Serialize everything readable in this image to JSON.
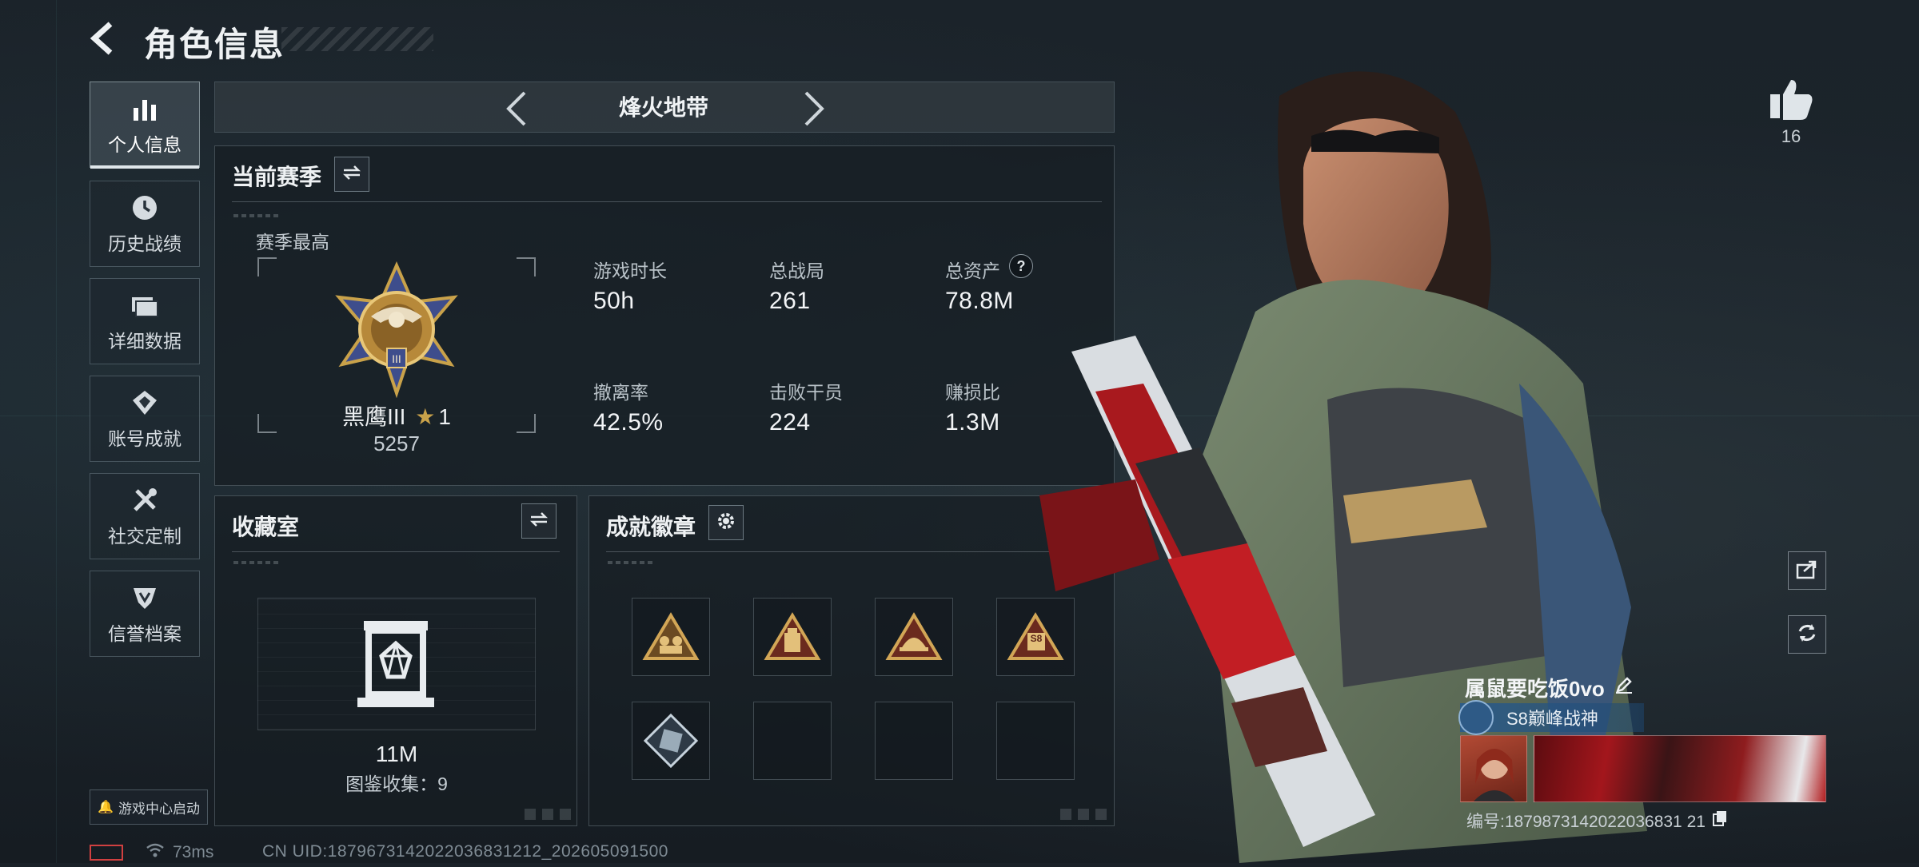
{
  "header": {
    "title": "角色信息"
  },
  "sidebar": {
    "items": [
      {
        "label": "个人信息",
        "icon": "bar-chart-icon",
        "active": true
      },
      {
        "label": "历史战绩",
        "icon": "clock-icon",
        "active": false
      },
      {
        "label": "详细数据",
        "icon": "folder-icon",
        "active": false
      },
      {
        "label": "账号成就",
        "icon": "achievement-icon",
        "active": false
      },
      {
        "label": "社交定制",
        "icon": "tools-icon",
        "active": false
      },
      {
        "label": "信誉档案",
        "icon": "shield-icon",
        "active": false
      }
    ],
    "launch_label": "游戏中心启动"
  },
  "status": {
    "ping": "73ms",
    "uid": "CN UID:1879673142022036831212_202605091500"
  },
  "mode": {
    "title": "烽火地带"
  },
  "season": {
    "title": "当前赛季",
    "highest_label": "赛季最高",
    "rank_name": "黑鹰III",
    "rank_stars": "1",
    "rank_score": "5257",
    "stats": [
      {
        "label": "游戏时长",
        "value": "50h"
      },
      {
        "label": "总战局",
        "value": "261"
      },
      {
        "label": "总资产",
        "value": "78.8M",
        "help": "?"
      },
      {
        "label": "撤离率",
        "value": "42.5%"
      },
      {
        "label": "击败干员",
        "value": "224"
      },
      {
        "label": "赚损比",
        "value": "1.3M"
      }
    ]
  },
  "collection": {
    "title": "收藏室",
    "value": "11M",
    "catalog": "图鉴收集：9"
  },
  "achievements": {
    "title": "成就徽章",
    "badges": [
      {
        "name": "squad-badge-icon",
        "filled": true
      },
      {
        "name": "supply-badge-icon",
        "filled": true
      },
      {
        "name": "helmet-badge-icon",
        "filled": true
      },
      {
        "name": "s8-badge-icon",
        "filled": true,
        "text": "S8"
      },
      {
        "name": "crate-badge-icon",
        "filled": true
      },
      {
        "name": "empty-slot",
        "filled": false
      },
      {
        "name": "empty-slot",
        "filled": false
      },
      {
        "name": "empty-slot",
        "filled": false
      }
    ]
  },
  "profile": {
    "likes": "16",
    "player_name": "属鼠要吃饭0vo",
    "rank_title": "S8巅峰战神",
    "serial": "编号:1879873142022036831 21"
  },
  "colors": {
    "accent_gold": "#c9a24a",
    "panel_border": "#5d6a73",
    "rank_blue": "#2a5a8a"
  }
}
